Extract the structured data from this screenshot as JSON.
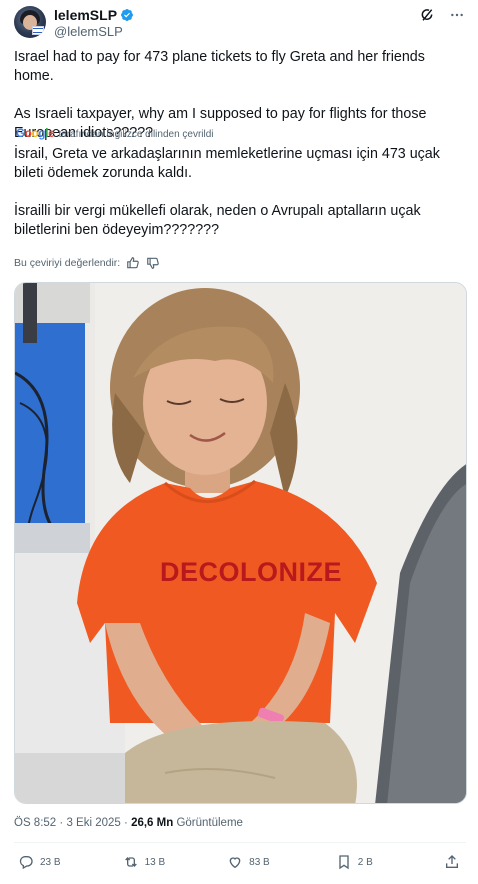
{
  "author": {
    "display_name": "lelemSLP",
    "handle": "@lelemSLP",
    "verified": true,
    "avatar_icon": "avatar-icon"
  },
  "header_icons": [
    "grok-icon",
    "more-icon"
  ],
  "tweet": {
    "lines": [
      "Israel had to pay for 473 plane tickets to fly Greta and her friends home.",
      "As Israeli taxpayer, why am I supposed to pay for flights for those European idiots?????"
    ]
  },
  "translation": {
    "provider": "Google",
    "note": "tarafından İngilizce dilinden çevrildi",
    "lines": [
      "İsrail, Greta ve arkadaşlarının memleketlerine uçması için 473 uçak bileti ödemek zorunda kaldı.",
      "İsrailli bir vergi mükellefi olarak, neden o Avrupalı aptalların uçak biletlerini ben ödeyeyim???????"
    ],
    "rate_label": "Bu çeviriyi değerlendir:"
  },
  "photo": {
    "shirt_text": "DECOLONIZE",
    "colors": {
      "shirt": "#f05a22",
      "wall": "#eceae6",
      "blue_panel": "#2f6fd0"
    }
  },
  "meta": {
    "time": "ÖS 8:52",
    "sep": "·",
    "date": "3 Eki 2025",
    "views_count": "26,6 Mn",
    "views_label": "Görüntüleme"
  },
  "actions": {
    "replies": "23 B",
    "reposts": "13 B",
    "likes": "83 B",
    "bookmarks": "2 B"
  },
  "colors": {
    "text": "#0f1419",
    "secondary": "#536471",
    "verified": "#1d9bf0"
  }
}
